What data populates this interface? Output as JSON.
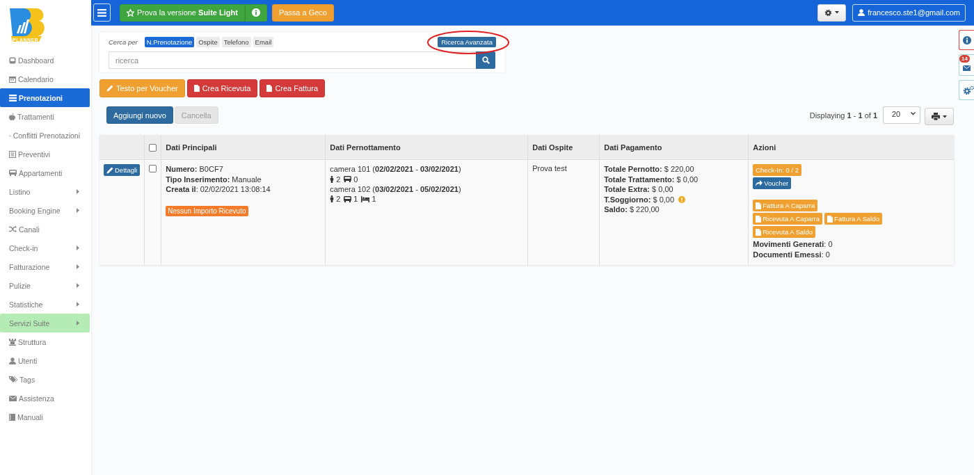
{
  "sidebar": {
    "logo_caption": "PLANNER",
    "items": [
      {
        "label": "Dashboard",
        "kind": "icon",
        "selected": false,
        "highlighted": false
      },
      {
        "label": "Calendario",
        "kind": "icon",
        "selected": false,
        "highlighted": false
      },
      {
        "label": "Prenotazioni",
        "kind": "icon",
        "selected": true,
        "highlighted": false
      },
      {
        "label": "Trattamenti",
        "kind": "icon",
        "selected": false,
        "highlighted": false
      },
      {
        "label": "Conflitti Prenotazioni",
        "kind": "icon",
        "selected": false,
        "highlighted": false
      },
      {
        "label": "Preventivi",
        "kind": "icon",
        "selected": false,
        "highlighted": false
      },
      {
        "label": "Appartamenti",
        "kind": "icon",
        "selected": false,
        "highlighted": false
      },
      {
        "label": "Listino",
        "kind": "submenu",
        "selected": false,
        "highlighted": false
      },
      {
        "label": "Booking Engine",
        "kind": "submenu",
        "selected": false,
        "highlighted": false
      },
      {
        "label": "Canali",
        "kind": "icon",
        "selected": false,
        "highlighted": false
      },
      {
        "label": "Check-in",
        "kind": "submenu",
        "selected": false,
        "highlighted": false
      },
      {
        "label": "Fatturazione",
        "kind": "submenu",
        "selected": false,
        "highlighted": false
      },
      {
        "label": "Pulizie",
        "kind": "submenu",
        "selected": false,
        "highlighted": false
      },
      {
        "label": "Statistiche",
        "kind": "submenu",
        "selected": false,
        "highlighted": false
      },
      {
        "label": "Servizi Suite",
        "kind": "submenu",
        "selected": false,
        "highlighted": true
      },
      {
        "label": "Struttura",
        "kind": "icon",
        "selected": false,
        "highlighted": false
      },
      {
        "label": "Utenti",
        "kind": "icon",
        "selected": false,
        "highlighted": false
      },
      {
        "label": "Tags",
        "kind": "icon",
        "selected": false,
        "highlighted": false
      },
      {
        "label": "Assistenza",
        "kind": "icon",
        "selected": false,
        "highlighted": false
      },
      {
        "label": "Manuali",
        "kind": "icon",
        "selected": false,
        "highlighted": false
      }
    ]
  },
  "topbar": {
    "promo_button": "Prova la versione **Suite Light**",
    "geco_button": "Passa a Geco",
    "user_button": "francesco.ste1@gmail.com"
  },
  "side_tools": [
    {
      "kind": "info"
    },
    {
      "kind": "mail",
      "badge": "14"
    },
    {
      "kind": "settings"
    }
  ],
  "search": {
    "label": "Cerca per",
    "filters": [
      {
        "label": "N.Prenotazione",
        "selected": true
      },
      {
        "label": "Ospite",
        "selected": false
      },
      {
        "label": "Telefono",
        "selected": false
      },
      {
        "label": "Email",
        "selected": false
      }
    ],
    "advanced_button": "Ricerca Avanzata",
    "placeholder": "ricerca"
  },
  "action_buttons": [
    {
      "label": "Testo per Voucher",
      "kind": "edit"
    },
    {
      "label": "Crea Ricevuta",
      "kind": "document"
    },
    {
      "label": "Crea Fattura",
      "kind": "document"
    }
  ],
  "list_buttons": [
    {
      "label": "Aggiungi nuovo",
      "disabled": false
    },
    {
      "label": "Cancella",
      "disabled": true
    }
  ],
  "pagination": {
    "summary": "Displaying **1** - **1** of **1**",
    "page_size": "20"
  },
  "table": {
    "columns": [
      "Dati Principali",
      "Dati Pernottamento",
      "Dati Ospite",
      "Dati Pagamento",
      "Azioni"
    ],
    "header_checked": false,
    "rows": [
      {
        "details_button": "Dettagli",
        "checked": false,
        "main_lines": [
          "**Numero:** B0CF7",
          "**Tipo Inserimento:** Manuale",
          "**Creata il**: 02/02/2021 13:08:14"
        ],
        "status_label": "Nessun Importo Ricevuto",
        "stays": [
          {
            "room": "camera 101 (**02/02/2021** - **03/02/2021**)",
            "counts": [
              {
                "kind": "guests",
                "value": "2"
              },
              {
                "kind": "vehicle",
                "value": "0"
              }
            ]
          },
          {
            "room": "camera 102 (**03/02/2021** - **05/02/2021**)",
            "counts": [
              {
                "kind": "guests",
                "value": "2"
              },
              {
                "kind": "vehicle",
                "value": "1"
              },
              {
                "kind": "bed",
                "value": "1"
              }
            ]
          }
        ],
        "guest": "Prova test",
        "payment": [
          {
            "text": "**Totale Pernotto:** $ 220,00",
            "alert": false
          },
          {
            "text": "**Totale Trattamento:** $ 0,00",
            "alert": false
          },
          {
            "text": "**Totale Extra:** $ 0,00",
            "alert": false
          },
          {
            "text": "**T.Soggiorno:** $ 0,00",
            "alert": true
          },
          {
            "text": "**Saldo:** $ 220,00",
            "alert": false
          }
        ],
        "checkin_button": "Check-In: 0 / 2",
        "voucher_button": "Voucher",
        "document_buttons": [
          "Fattura A Caparra",
          "Ricevuta A Caparra",
          "Fattura A Saldo",
          "Ricevuta A Saldo"
        ],
        "stats": [
          "**Movimenti Generati**: 0",
          "**Documenti Emessi**: 0"
        ]
      }
    ]
  }
}
